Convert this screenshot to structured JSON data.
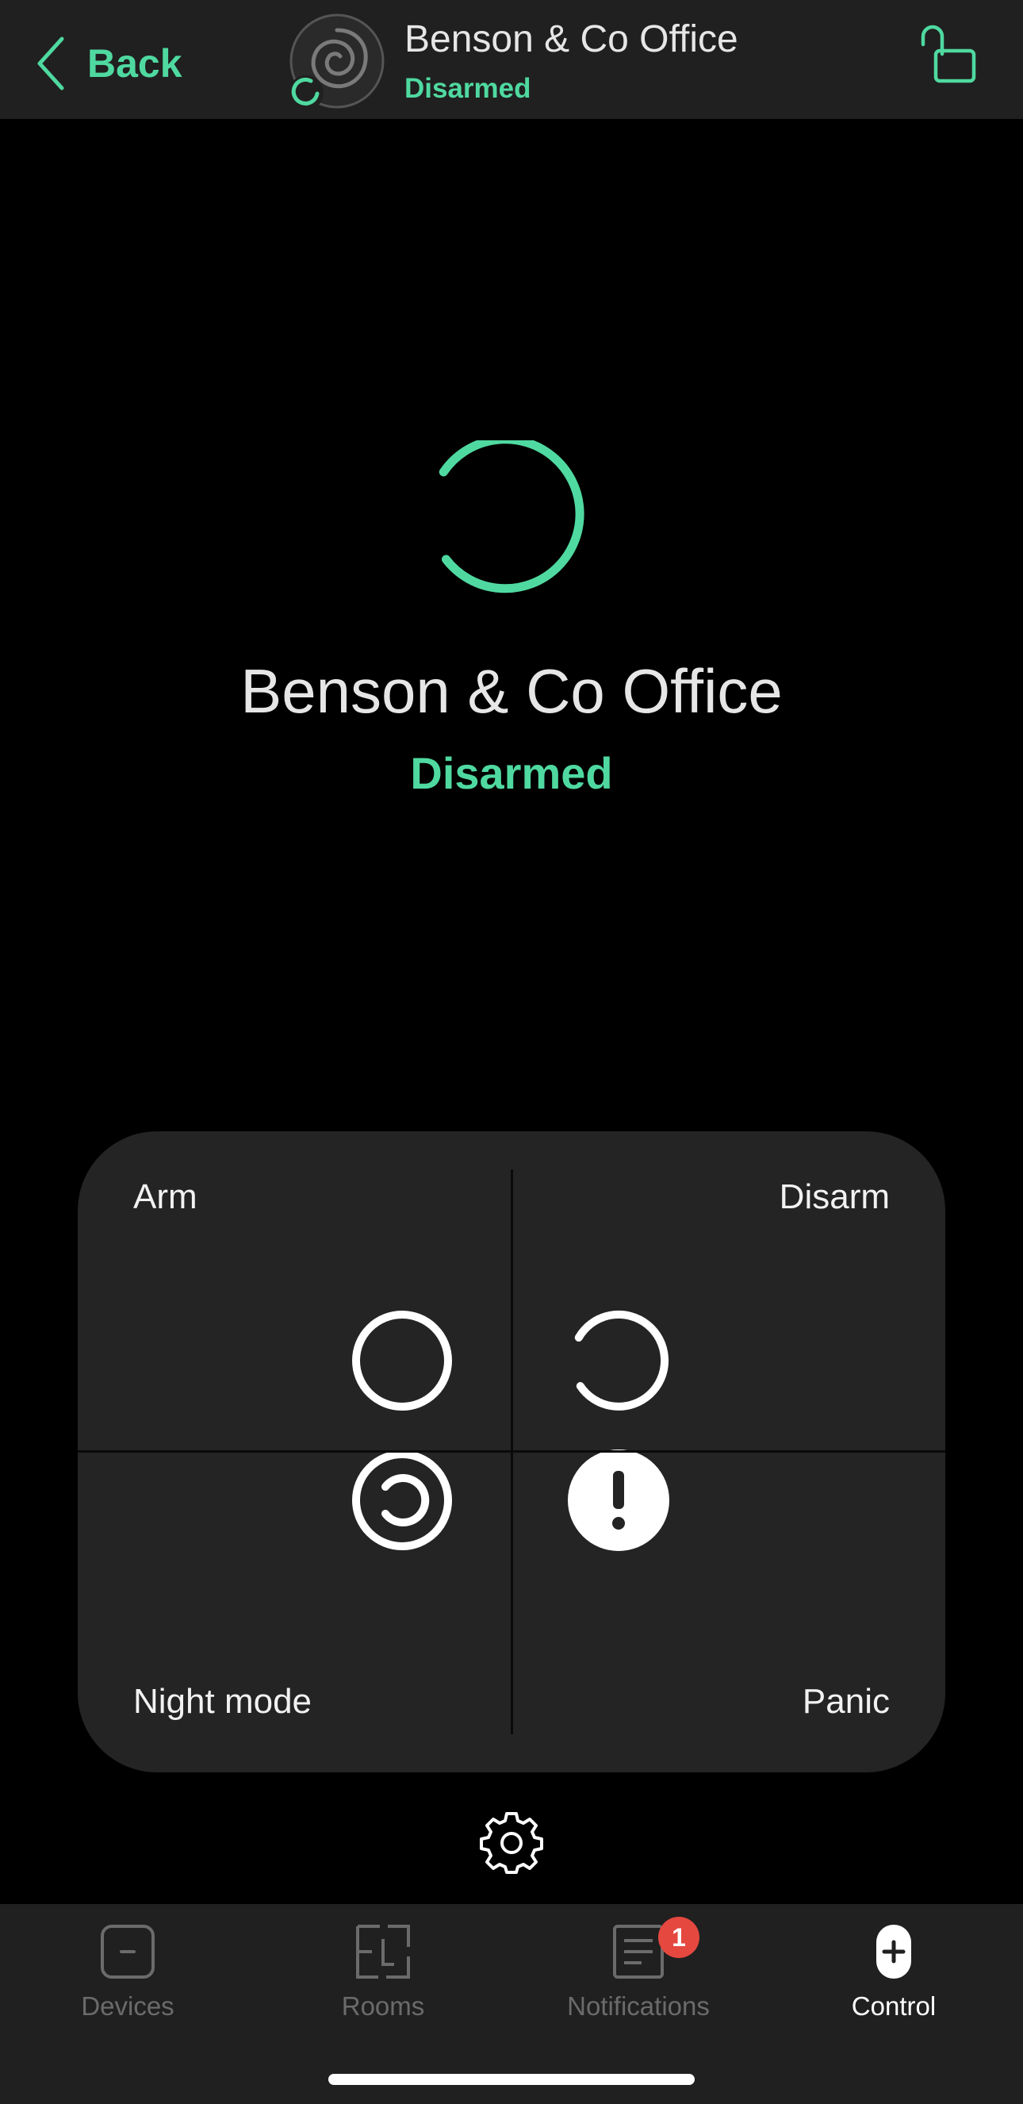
{
  "header": {
    "back_label": "Back",
    "title": "Benson & Co Office",
    "status": "Disarmed"
  },
  "main": {
    "title": "Benson & Co Office",
    "status": "Disarmed"
  },
  "controls": {
    "arm": "Arm",
    "disarm": "Disarm",
    "night_mode": "Night mode",
    "panic": "Panic"
  },
  "tabs": [
    {
      "label": "Devices",
      "icon": "devices-icon",
      "active": false
    },
    {
      "label": "Rooms",
      "icon": "rooms-icon",
      "active": false
    },
    {
      "label": "Notifications",
      "icon": "notifications-icon",
      "active": false,
      "badge": "1"
    },
    {
      "label": "Control",
      "icon": "control-icon",
      "active": true
    }
  ],
  "colors": {
    "accent": "#4fd9a0",
    "badge": "#e5483f",
    "panel": "#242424",
    "bar": "#202020"
  }
}
